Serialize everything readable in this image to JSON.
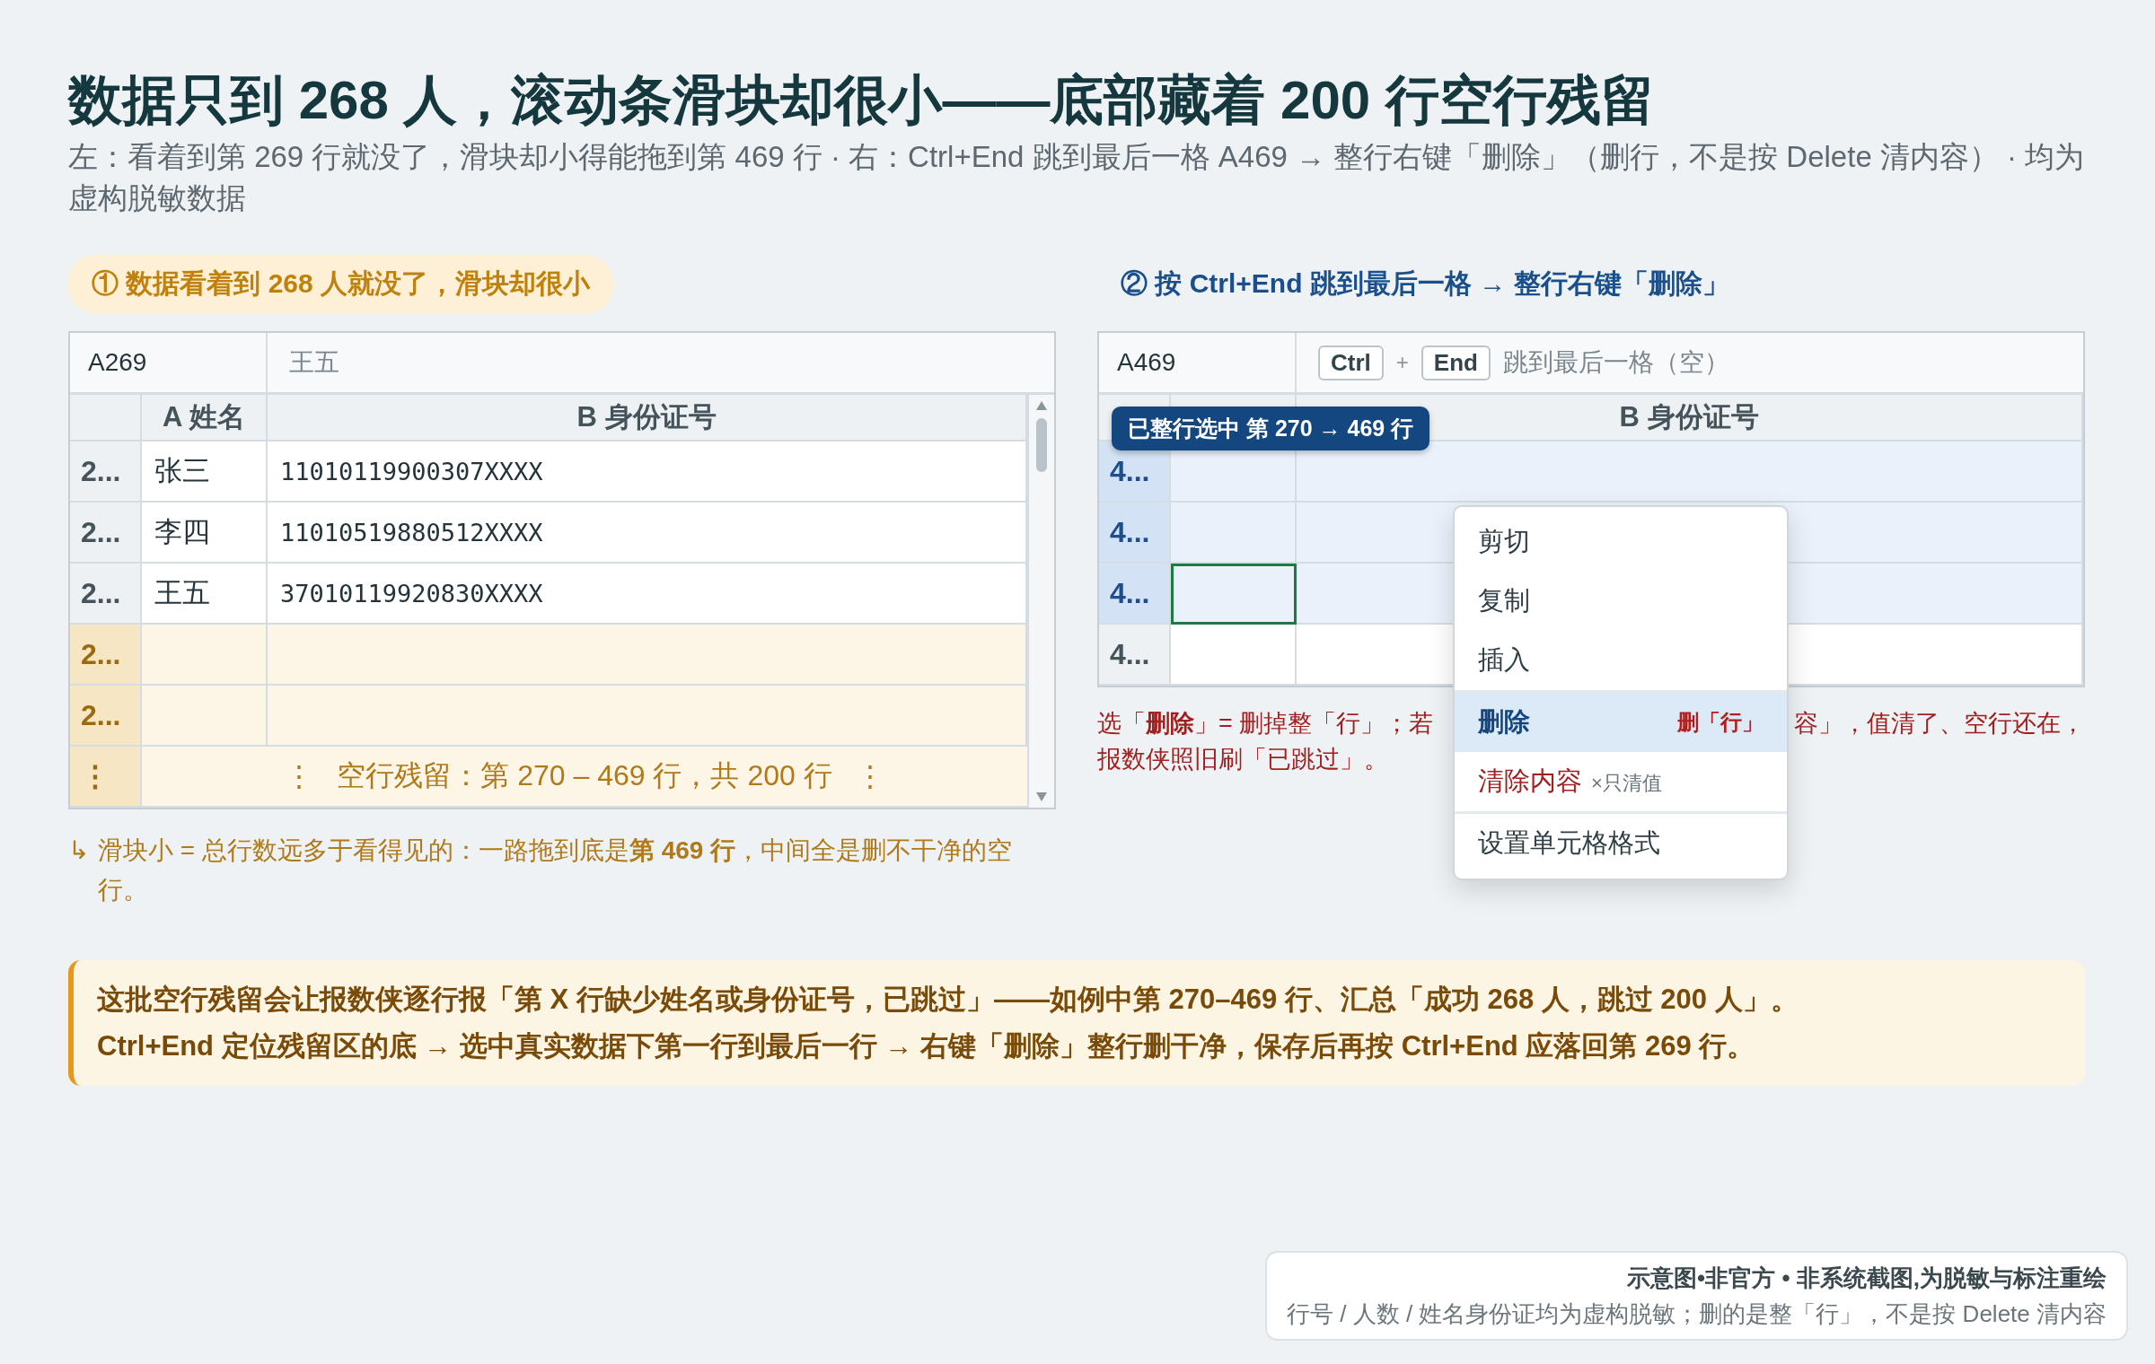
{
  "title": "数据只到 268 人，滚动条滑块却很小——底部藏着 200 行空行残留",
  "subtitle": "左：看着到第 269 行就没了，滑块却小得能拖到第 469 行 · 右：Ctrl+End 跳到最后一格 A469 → 整行右键「删除」（删行，不是按 Delete 清内容） · 均为虚构脱敏数据",
  "left": {
    "heading": "① 数据看着到 268 人就没了，滑块却很小",
    "name_box": "A269",
    "formula": "王五",
    "columns": [
      "A 姓名",
      "B 身份证号"
    ],
    "rows": [
      {
        "kind": "data",
        "row": "2...",
        "name": "张三",
        "id": "11010119900307XXXX"
      },
      {
        "kind": "data",
        "row": "2...",
        "name": "李四",
        "id": "11010519880512XXXX"
      },
      {
        "kind": "data",
        "row": "2...",
        "name": "王五",
        "id": "37010119920830XXXX"
      },
      {
        "kind": "empty",
        "row": "2..."
      },
      {
        "kind": "empty",
        "row": "2..."
      },
      {
        "kind": "gap",
        "row": "⋮",
        "marker": "⋮",
        "text": "空行残留：第 270 – 469 行，共 200 行",
        "marker_end": "⋮"
      }
    ],
    "note_icon": "↳",
    "note": "滑块小 = 总行数远多于看得见的：一路拖到底是**第 469 行**，中间全是删不干净的空行。"
  },
  "right": {
    "heading": "② 按 Ctrl+End 跳到最后一格 → 整行右键「删除」",
    "name_box": "A469",
    "keys": [
      "Ctrl",
      "End"
    ],
    "key_joiner": "+",
    "formula": "跳到最后一格（空）",
    "column_b": "B 身份证号",
    "badge": "已整行选中 第 270 → 469 行",
    "rows": [
      {
        "row": "4...",
        "selected": true,
        "active": false
      },
      {
        "row": "4...",
        "selected": true,
        "active": false
      },
      {
        "row": "4...",
        "selected": true,
        "active": true
      },
      {
        "row": "4...",
        "selected": false,
        "active": false
      }
    ],
    "menu": {
      "groups": [
        [
          {
            "label": "剪切",
            "selected": false,
            "kind": "plain"
          },
          {
            "label": "复制",
            "selected": false,
            "kind": "plain"
          },
          {
            "label": "插入",
            "selected": false,
            "kind": "plain"
          }
        ],
        [
          {
            "label": "删除",
            "selected": true,
            "kind": "plain",
            "hint": "删「行」"
          },
          {
            "label": "清除内容",
            "selected": false,
            "kind": "danger",
            "hint": "×只清值"
          }
        ],
        [
          {
            "label": "设置单元格格式",
            "selected": false,
            "kind": "plain"
          }
        ]
      ]
    },
    "note_before": "选「**删除**」= 删掉整「行」；若",
    "note_after": "容」，值清了、空行还在，",
    "note_line2": "报数侠照旧刷「已跳过」。"
  },
  "callout": [
    "这批空行残留会让报数侠逐行报「第 X 行缺少姓名或身份证号，已跳过」——如例中第 270–469 行、汇总「成功 268 人，跳过 200 人」。",
    "Ctrl+End 定位残留区的底 → 选中真实数据下第一行到最后一行 → 右键「删除」整行删干净，保存后再按 Ctrl+End 应落回第 269 行。"
  ],
  "footer": {
    "title": "示意图•非官方 • 非系统截图,为脱敏与标注重绘",
    "text": "行号 / 人数 / 姓名身份证均为虚构脱敏；删的是整「行」，不是按 Delete 清内容"
  }
}
